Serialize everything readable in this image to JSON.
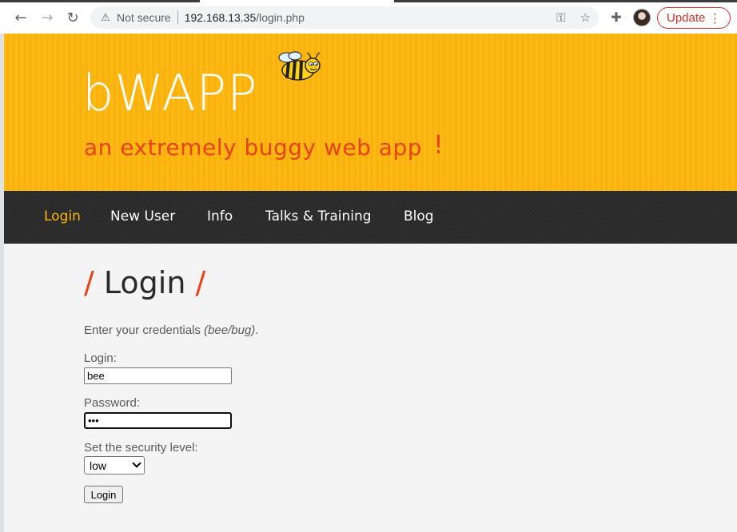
{
  "browser": {
    "security_label": "Not secure",
    "url_host": "192.168.13.35",
    "url_path": "/login.php",
    "update_label": "Update"
  },
  "site": {
    "logo": "bWAPP",
    "tagline": "an extremely buggy web app",
    "tagline_bang": "!"
  },
  "menu": {
    "items": [
      "Login",
      "New User",
      "Info",
      "Talks & Training",
      "Blog"
    ],
    "active": "Login"
  },
  "login": {
    "title": "Login",
    "title_slash": "/",
    "intro_prefix": "Enter your credentials ",
    "intro_hint": "(bee/bug)",
    "intro_suffix": ".",
    "login_label": "Login:",
    "login_value": "bee",
    "password_label": "Password:",
    "password_value": "•••",
    "security_label": "Set the security level:",
    "security_value": "low",
    "submit_label": "Login"
  },
  "colors": {
    "header_bg": "#ffb60c",
    "accent": "#e8421a",
    "menu_bg": "#2a2a2a"
  }
}
